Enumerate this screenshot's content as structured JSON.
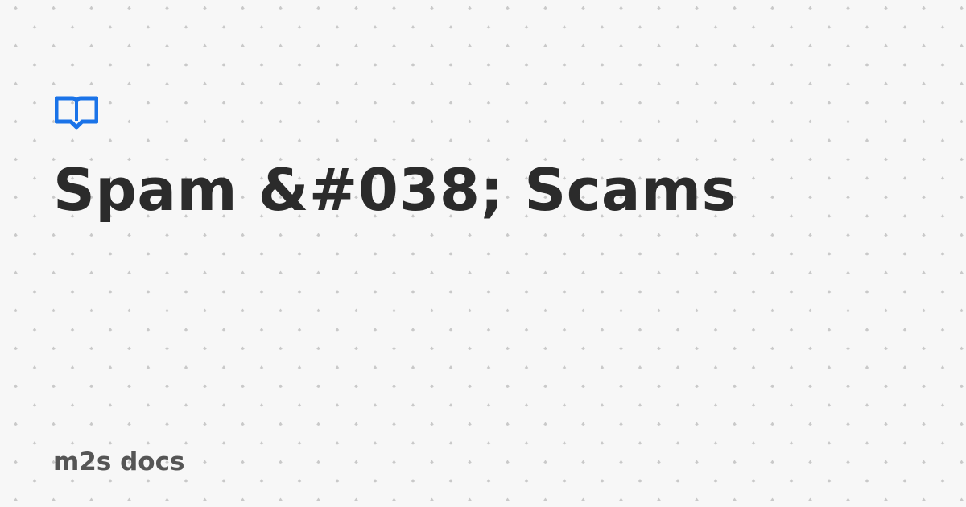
{
  "card": {
    "title": "Spam &#038; Scams",
    "site_name": "m2s docs",
    "logo_icon": "book-open-icon"
  },
  "colors": {
    "background": "#f7f7f7",
    "dots": "#c9c9c9",
    "title": "#2b2b2b",
    "site_name": "#555555",
    "accent": "#1a73e8"
  }
}
